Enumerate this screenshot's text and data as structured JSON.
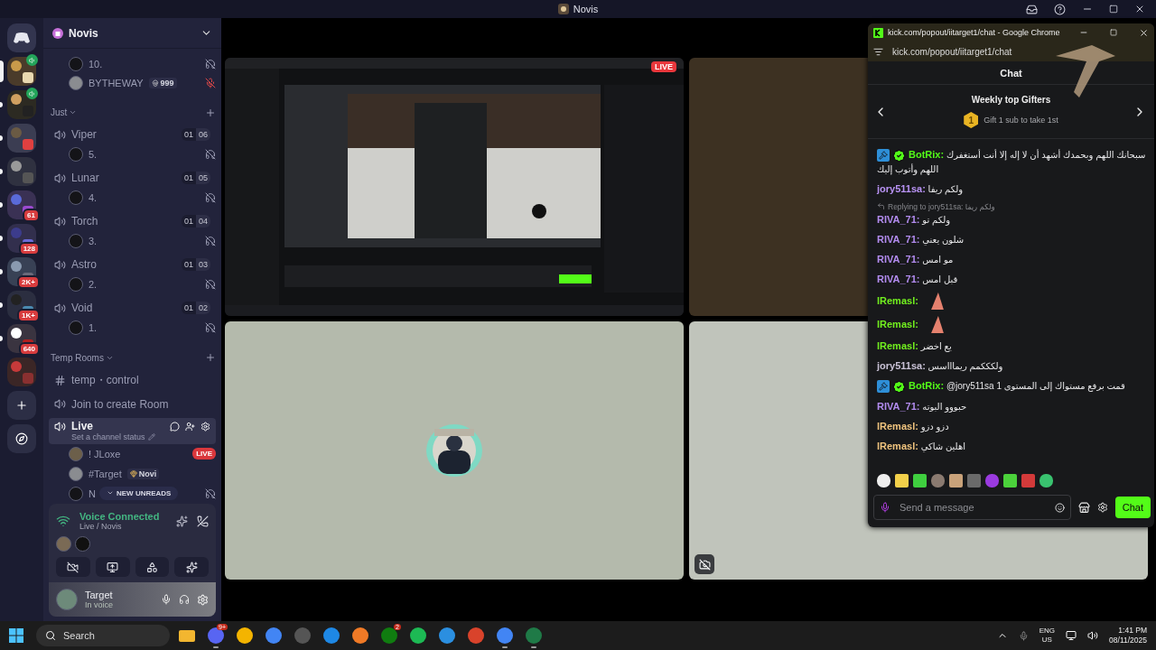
{
  "titlebar": {
    "title": "Novis"
  },
  "servers": [
    {
      "selected": true,
      "unread": false,
      "voice": true
    },
    {
      "selected": false,
      "unread": true,
      "voice": true
    },
    {
      "selected": false,
      "unread": true,
      "voice": false
    },
    {
      "selected": false,
      "unread": true,
      "voice": false
    },
    {
      "selected": false,
      "unread": true,
      "voice": false,
      "badge": "61"
    },
    {
      "selected": false,
      "unread": true,
      "voice": false,
      "badge": "128"
    },
    {
      "selected": false,
      "unread": true,
      "voice": false,
      "badge": "2K+"
    },
    {
      "selected": false,
      "unread": true,
      "voice": false,
      "badge": "1K+"
    },
    {
      "selected": false,
      "unread": true,
      "voice": false,
      "badge": "640"
    },
    {
      "selected": false,
      "unread": false,
      "voice": false
    }
  ],
  "sidebar": {
    "server_name": "Novis",
    "top_members": [
      {
        "name": "10.",
        "deafened": true
      },
      {
        "name": "BYTHEWAY",
        "tag": "999",
        "muted": true
      }
    ],
    "categories": [
      {
        "name": "Just",
        "channels": [
          {
            "kind": "voice",
            "name": "Viper",
            "count": "01",
            "limit": "06",
            "selected": false,
            "members": [
              {
                "name": "5.",
                "deafened": true
              }
            ]
          },
          {
            "kind": "voice",
            "name": "Lunar",
            "count": "01",
            "limit": "05",
            "selected": false,
            "members": [
              {
                "name": "4.",
                "deafened": true
              }
            ]
          },
          {
            "kind": "voice",
            "name": "Torch",
            "count": "01",
            "limit": "04",
            "selected": false,
            "members": [
              {
                "name": "3.",
                "deafened": true
              }
            ]
          },
          {
            "kind": "voice",
            "name": "Astro",
            "count": "01",
            "limit": "03",
            "selected": false,
            "members": [
              {
                "name": "2.",
                "deafened": true
              }
            ]
          },
          {
            "kind": "voice",
            "name": "Void",
            "count": "01",
            "limit": "02",
            "selected": false,
            "members": [
              {
                "name": "1.",
                "deafened": true
              }
            ]
          }
        ]
      },
      {
        "name": "Temp Rooms",
        "channels": [
          {
            "kind": "text",
            "name": "temp・control",
            "selected": false
          },
          {
            "kind": "voice",
            "name": "Join to create Room",
            "selected": false
          },
          {
            "kind": "voice",
            "name": "Live",
            "selected": true,
            "status": "Set a channel status",
            "members": [
              {
                "name": "! JLoxe",
                "badge": "LIVE"
              },
              {
                "name": "#Target",
                "tag": "Novi"
              },
              {
                "name": "N",
                "deafened": true
              }
            ]
          }
        ]
      }
    ],
    "new_unreads": "NEW UNREADS",
    "voice_panel": {
      "title": "Voice Connected",
      "subtitle": "Live / Novis"
    },
    "user_panel": {
      "name": "Target",
      "status": "In voice"
    }
  },
  "stage": {
    "tiles": [
      {
        "kind": "screen",
        "badge": "LIVE"
      },
      {
        "kind": "blank"
      },
      {
        "kind": "avatar"
      },
      {
        "kind": "camera-off"
      }
    ]
  },
  "popout": {
    "title": "kick.com/popout/iitarget1/chat - Google Chrome",
    "url": "kick.com/popout/iitarget1/chat",
    "header": "Chat",
    "gifters": {
      "title": "Weekly top Gifters",
      "rank": "1",
      "text": "Gift 1 sub to take 1st"
    },
    "messages": [
      {
        "kind": "text",
        "user": "BotRix:",
        "color": "#53fc18",
        "moderator": true,
        "verified": true,
        "text": "سبحانك اللهم وبحمدك أشهد أن لا إله إلا أنت أستغفرك اللهم وأتوب إليك"
      },
      {
        "kind": "text",
        "user": "jory511sa:",
        "color": "#b993f5",
        "text": "ولكم ريفا"
      },
      {
        "kind": "reply",
        "text": "Replying to jory511sa: ولكم ريفا"
      },
      {
        "kind": "text",
        "user": "RIVA_71:",
        "color": "#b38cf0",
        "text": "ولكم تو"
      },
      {
        "kind": "text",
        "user": "RIVA_71:",
        "color": "#b38cf0",
        "text": "شلون يعني"
      },
      {
        "kind": "text",
        "user": "RIVA_71:",
        "color": "#b38cf0",
        "text": "مو امس"
      },
      {
        "kind": "text",
        "user": "RIVA_71:",
        "color": "#b38cf0",
        "text": "قبل امس"
      },
      {
        "kind": "emote",
        "user": "lRemasl:",
        "color": "#72f01f"
      },
      {
        "kind": "emote",
        "user": "lRemasl:",
        "color": "#72f01f"
      },
      {
        "kind": "text",
        "user": "lRemasl:",
        "color": "#72f01f",
        "text": "يع اخضر"
      },
      {
        "kind": "text",
        "user": "jory511sa:",
        "color": "#c9c2d6",
        "text": "ولكككمم ريماااسس"
      },
      {
        "kind": "text",
        "user": "BotRix:",
        "color": "#53fc18",
        "moderator": true,
        "verified": true,
        "text": "@jory511sa قمت برفع مستواك إلى المستوى 1"
      },
      {
        "kind": "text",
        "user": "RIVA_71:",
        "color": "#b38cf0",
        "text": "حبووو البوته"
      },
      {
        "kind": "text",
        "user": "lRemasl:",
        "color": "#f0c47e",
        "text": "دزو دزو"
      },
      {
        "kind": "text",
        "user": "lRemasl:",
        "color": "#f0c47e",
        "text": "اهلين شاكي"
      }
    ],
    "input": {
      "placeholder": "Send a message"
    },
    "send": "Chat"
  },
  "taskbar": {
    "search": "Search",
    "apps": [
      {
        "kind": "folder",
        "running": false
      },
      {
        "kind": "discord",
        "running": true,
        "badge": "9+"
      },
      {
        "kind": "chat",
        "running": false
      },
      {
        "kind": "chrome",
        "running": false
      },
      {
        "kind": "recorder",
        "running": false
      },
      {
        "kind": "bluetooth",
        "running": false
      },
      {
        "kind": "launcher",
        "running": false
      },
      {
        "kind": "xbox",
        "running": false,
        "badge": "2"
      },
      {
        "kind": "spotify",
        "running": false
      },
      {
        "kind": "vscode",
        "running": false
      },
      {
        "kind": "tool",
        "running": false
      },
      {
        "kind": "chrome",
        "running": true
      },
      {
        "kind": "sheet",
        "running": true
      }
    ],
    "lang": "ENG",
    "region": "US",
    "time": "1:41 PM",
    "date": "08/11/2025"
  }
}
